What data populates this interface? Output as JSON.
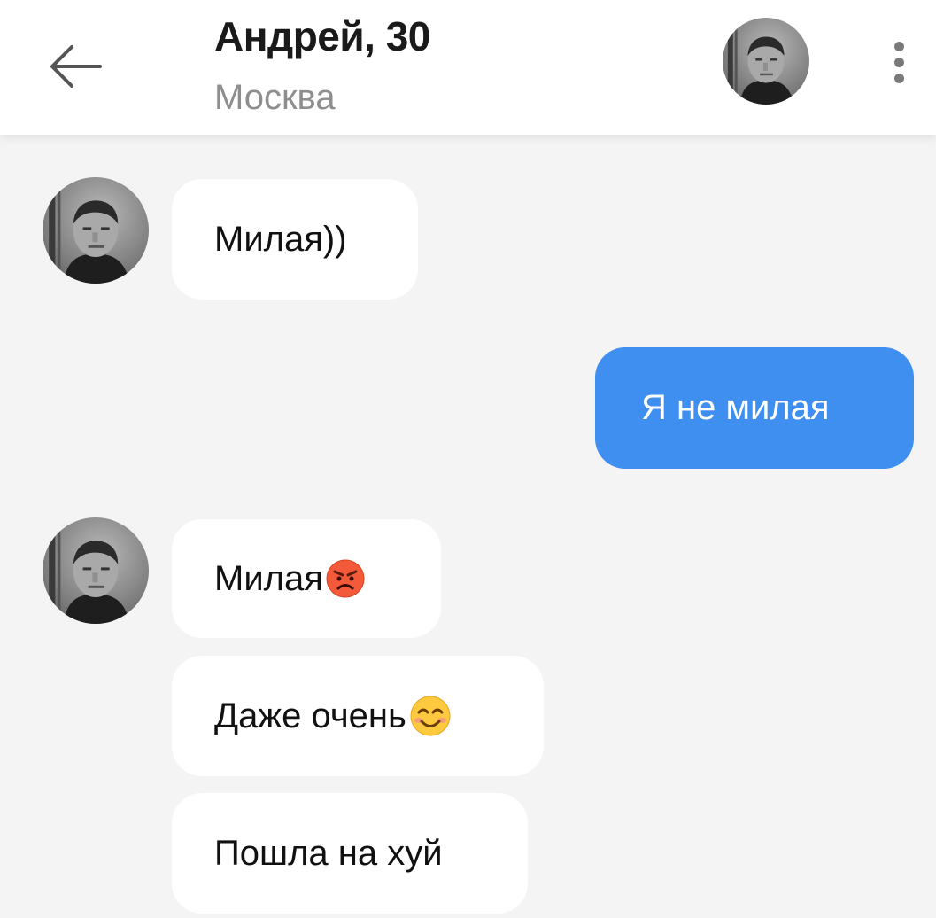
{
  "header": {
    "name_age": "Андрей, 30",
    "city": "Москва",
    "back_icon": "arrow-left-icon",
    "more_icon": "more-vertical-icon"
  },
  "colors": {
    "outgoing_bubble": "#3f8ff0",
    "incoming_bubble": "#ffffff",
    "background": "#f4f4f4"
  },
  "messages": [
    {
      "direction": "incoming",
      "text": "Милая))"
    },
    {
      "direction": "outgoing",
      "text": "Я не милая"
    },
    {
      "direction": "incoming",
      "text": "Милая",
      "emoji": "angry-face-emoji"
    },
    {
      "direction": "incoming",
      "text": "Даже очень",
      "emoji": "smiling-face-emoji"
    },
    {
      "direction": "incoming",
      "text": "Пошла на хуй"
    }
  ]
}
